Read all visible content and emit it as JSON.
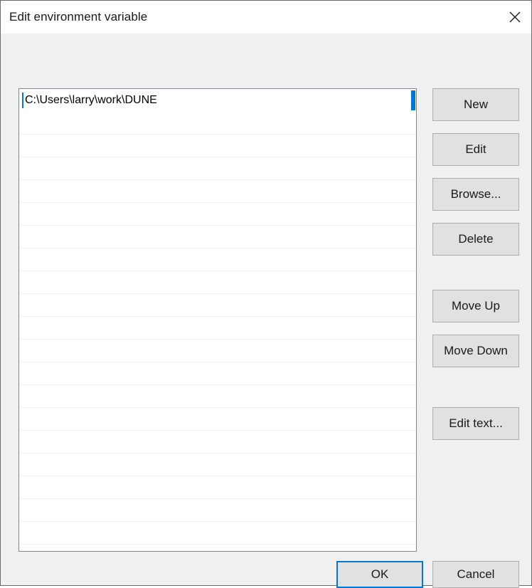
{
  "window": {
    "title": "Edit environment variable",
    "close_icon": "close-icon",
    "background_color": "#f0f0f0",
    "titlebar_color": "#ffffff",
    "accent_color": "#0078d7"
  },
  "list": {
    "row_count": 21,
    "editing_row_index": 0,
    "entries": [
      "C:\\Users\\larry\\work\\DUNE",
      "",
      "",
      "",
      "",
      "",
      "",
      "",
      "",
      "",
      "",
      "",
      "",
      "",
      "",
      "",
      "",
      "",
      "",
      "",
      ""
    ]
  },
  "side_buttons": [
    {
      "label": "New",
      "name": "new-button"
    },
    {
      "label": "Edit",
      "name": "edit-button"
    },
    {
      "label": "Browse...",
      "name": "browse-button"
    },
    {
      "label": "Delete",
      "name": "delete-button"
    },
    {
      "label": "Move Up",
      "name": "move-up-button"
    },
    {
      "label": "Move Down",
      "name": "move-down-button"
    },
    {
      "label": "Edit text...",
      "name": "edit-text-button"
    }
  ],
  "footer": {
    "ok_label": "OK",
    "cancel_label": "Cancel"
  }
}
